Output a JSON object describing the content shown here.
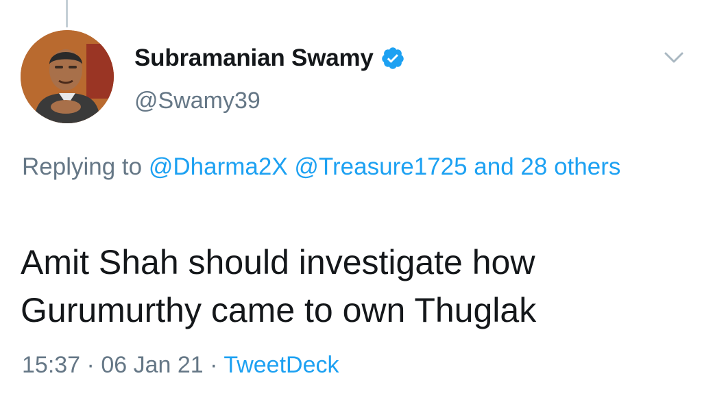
{
  "author": {
    "display_name": "Subramanian Swamy",
    "handle": "@Swamy39",
    "verified": true
  },
  "reply": {
    "prefix": "Replying to",
    "mentions": [
      "@Dharma2X",
      "@Treasure1725"
    ],
    "and_others": "and 28 others"
  },
  "tweet": {
    "text_line1": "Amit Shah should investigate how",
    "text_line2": "Gurumurthy came to own Thuglak"
  },
  "meta": {
    "time": "15:37",
    "date": "06 Jan 21",
    "source": "TweetDeck",
    "separator": "·"
  },
  "colors": {
    "link": "#1da1f2",
    "secondary_text": "#657786",
    "primary_text": "#14171a"
  },
  "icons": {
    "verified": "verified-badge-icon",
    "menu": "chevron-down-icon"
  }
}
